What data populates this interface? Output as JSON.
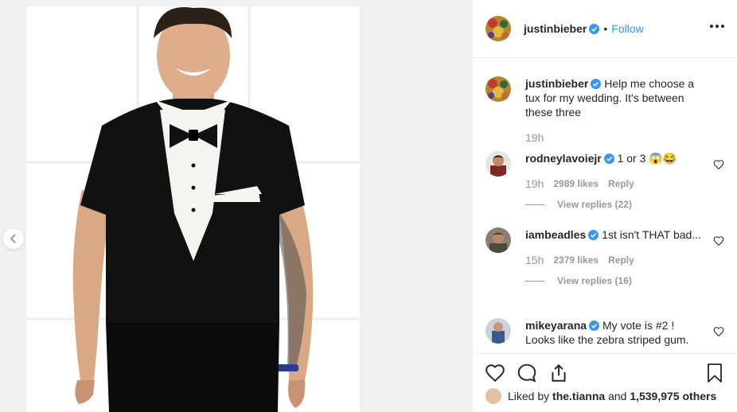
{
  "post": {
    "author": "justinbieber",
    "follow_label": "Follow",
    "dot": "•",
    "caption_text": "Help me choose a tux for my wedding. It's between these three",
    "caption_time": "19h"
  },
  "comments": [
    {
      "user": "rodneylavoiejr",
      "text": "1 or 3 😱😂",
      "time": "19h",
      "likes": "2989 likes",
      "reply_label": "Reply",
      "view_replies": "View replies (22)"
    },
    {
      "user": "iambeadles",
      "text": "1st isn't THAT bad...",
      "time": "15h",
      "likes": "2379 likes",
      "reply_label": "Reply",
      "view_replies": "View replies (16)"
    },
    {
      "user": "mikeyarana",
      "text": "My vote is #2 ! Looks like the zebra striped gum.",
      "time": "",
      "likes": "",
      "reply_label": "",
      "view_replies": ""
    }
  ],
  "likes_bar": {
    "prefix": "Liked by",
    "first_liker": "the.tianna",
    "joiner": "and",
    "others": "1,539,975 others"
  },
  "icons": {
    "prev": "chevron-left-icon",
    "verified": "verified-badge-icon",
    "more": "more-options-icon",
    "like": "heart-icon",
    "comment": "comment-icon",
    "share": "share-icon",
    "save": "bookmark-icon"
  },
  "colors": {
    "link": "#3897f0",
    "verified": "#3897f0",
    "muted": "#999999",
    "text": "#262626"
  }
}
